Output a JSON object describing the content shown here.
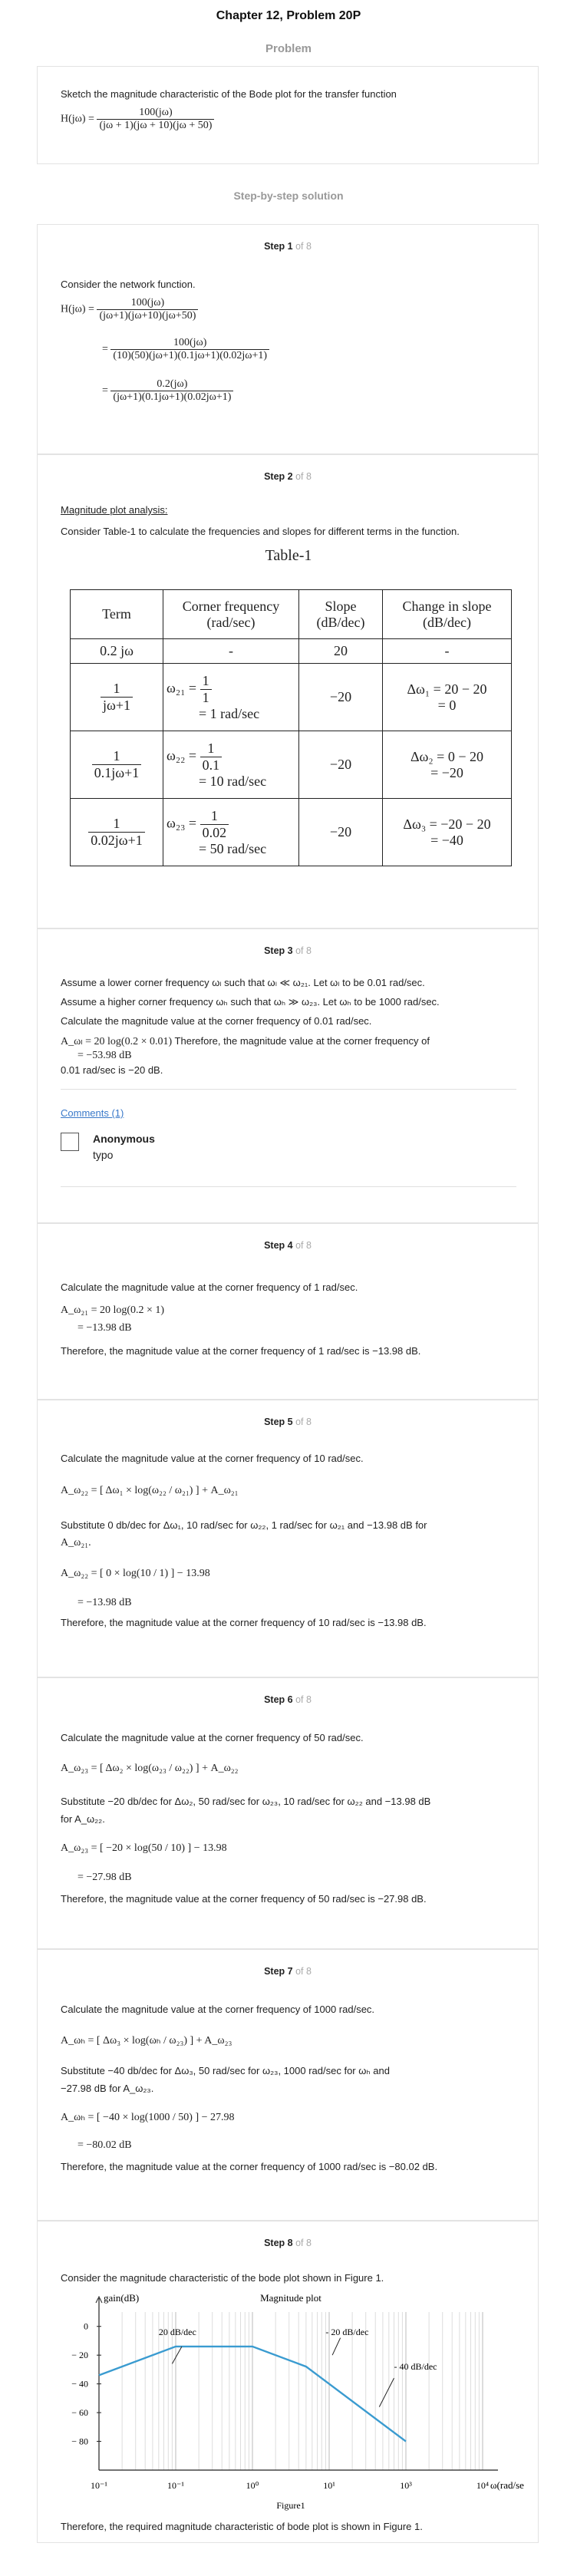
{
  "header": {
    "title": "Chapter 12, Problem 20P",
    "problem_label": "Problem",
    "solution_label": "Step-by-step solution"
  },
  "problem": {
    "text": "Sketch the magnitude characteristic of the Bode plot for the transfer function",
    "lhs": "H(jω) =",
    "num": "100(jω)",
    "den": "(jω + 1)(jω + 10)(jω + 50)"
  },
  "steps": [
    {
      "label": "Step 1",
      "of": "of 8"
    },
    {
      "label": "Step 2",
      "of": "of 8"
    },
    {
      "label": "Step 3",
      "of": "of 8"
    },
    {
      "label": "Step 4",
      "of": "of 8"
    },
    {
      "label": "Step 5",
      "of": "of 8"
    },
    {
      "label": "Step 6",
      "of": "of 8"
    },
    {
      "label": "Step 7",
      "of": "of 8"
    },
    {
      "label": "Step 8",
      "of": "of 8"
    }
  ],
  "step1": {
    "intro": "Consider the network function.",
    "lhs": "H(jω) =",
    "f1_num": "100(jω)",
    "f1_den": "(jω+1)(jω+10)(jω+50)",
    "f2_num": "100(jω)",
    "f2_den": "(10)(50)(jω+1)(0.1jω+1)(0.02jω+1)",
    "f3_num": "0.2(jω)",
    "f3_den": "(jω+1)(0.1jω+1)(0.02jω+1)"
  },
  "step2": {
    "heading": "Magnitude plot analysis:",
    "text": "Consider Table-1 to calculate the frequencies and slopes for different terms in the function.",
    "table_title": "Table-1",
    "headers": [
      "Term",
      "Corner frequency (rad/sec)",
      "Slope (dB/dec)",
      "Change in slope (dB/dec)"
    ],
    "row0": {
      "term": "0.2 jω",
      "freq": "-",
      "slope": "20",
      "change": "-"
    },
    "row1": {
      "num": "1",
      "den": "jω+1",
      "w": "ω₂₁ =",
      "fnum": "1",
      "fden": "1",
      "res": "= 1 rad/sec",
      "slope": "−20",
      "c1": "Δω₁ = 20 − 20",
      "c2": "= 0"
    },
    "row2": {
      "num": "1",
      "den": "0.1jω+1",
      "w": "ω₂₂ =",
      "fnum": "1",
      "fden": "0.1",
      "res": "= 10 rad/sec",
      "slope": "−20",
      "c1": "Δω₂ = 0 − 20",
      "c2": "= −20"
    },
    "row3": {
      "num": "1",
      "den": "0.02jω+1",
      "w": "ω₂₃ =",
      "fnum": "1",
      "fden": "0.02",
      "res": "= 50 rad/sec",
      "slope": "−20",
      "c1": "Δω₃ = −20 − 20",
      "c2": "= −40"
    }
  },
  "step3": {
    "l1": "Assume a lower corner frequency  ωₗ such that  ωₗ ≪ ω₂₁. Let  ωₗ to be  0.01 rad/sec.",
    "l2": "Assume a higher corner frequency  ωₕ such that  ωₕ ≫ ω₂₃. Let  ωₕ to be  1000 rad/sec.",
    "l3": "Calculate the magnitude value at the corner frequency of  0.01 rad/sec.",
    "eq1": "A_ωₗ = 20 log(0.2 × 0.01)",
    "eq1b": "Therefore, the magnitude value at the corner frequency of",
    "eq2": "= −53.98 dB",
    "eq3": "0.01 rad/sec  is  −20 dB.",
    "comments": "Comments (1)",
    "author": "Anonymous",
    "comment": "typo"
  },
  "step4": {
    "l1": "Calculate the magnitude value at the corner frequency of  1 rad/sec.",
    "eq1": "A_ω₂₁ = 20 log(0.2 × 1)",
    "eq2": "= −13.98 dB",
    "concl": "Therefore, the magnitude value at the corner frequency of  1 rad/sec  is  −13.98 dB."
  },
  "step5": {
    "l1": "Calculate the magnitude value at the corner frequency of  10 rad/sec.",
    "gen": "A_ω₂₂ = [ Δω₁ × log(ω₂₂ / ω₂₁) ] + A_ω₂₁",
    "sub1": "Substitute  0 db/dec  for  Δω₁,  10 rad/sec  for  ω₂₂,  1 rad/sec  for  ω₂₁  and  −13.98 dB  for",
    "sub2": "A_ω₂₁.",
    "eq": "A_ω₂₂ = [ 0 × log(10 / 1) ] − 13.98",
    "res": "= −13.98 dB",
    "concl": "Therefore, the magnitude value at the corner frequency of  10 rad/sec  is  −13.98 dB."
  },
  "step6": {
    "l1": "Calculate the magnitude value at the corner frequency of  50 rad/sec.",
    "gen": "A_ω₂₃ = [ Δω₂ × log(ω₂₃ / ω₂₂) ] + A_ω₂₂",
    "sub1": "Substitute  −20 db/dec  for  Δω₂,  50 rad/sec  for  ω₂₃,  10 rad/sec  for  ω₂₂  and  −13.98 dB",
    "sub2": "for  A_ω₂₂.",
    "eq": "A_ω₂₃ = [ −20 × log(50 / 10) ] − 13.98",
    "res": "= −27.98 dB",
    "concl": "Therefore, the magnitude value at the corner frequency of  50 rad/sec  is  −27.98 dB."
  },
  "step7": {
    "l1": "Calculate the magnitude value at the corner frequency of  1000 rad/sec.",
    "gen": "A_ωₕ = [ Δω₃ × log(ωₕ / ω₂₃) ] + A_ω₂₃",
    "sub1": "Substitute  −40 db/dec  for  Δω₃,  50 rad/sec  for  ω₂₃,  1000 rad/sec  for  ωₕ  and",
    "sub2": "−27.98 dB  for  A_ω₂₃.",
    "eq": "A_ωₕ = [ −40 × log(1000 / 50) ] − 27.98",
    "res": "= −80.02 dB",
    "concl": "Therefore, the magnitude value at the corner frequency of  1000 rad/sec  is  −80.02 dB."
  },
  "step8": {
    "l1": "Consider the magnitude characteristic of the bode plot shown in Figure 1.",
    "concl": "Therefore, the required magnitude characteristic of bode plot is shown in Figure 1."
  },
  "chart_data": {
    "type": "line",
    "title": "Magnitude plot",
    "xlabel": "ω(rad/sec)",
    "ylabel": "gain(dB)",
    "caption": "Figure1",
    "xscale": "log",
    "xlim": [
      0.1,
      10000
    ],
    "ylim": [
      -100,
      10
    ],
    "x_ticks": [
      "10⁻¹",
      "10⁻¹",
      "10⁰",
      "10¹",
      "10³",
      "10⁴"
    ],
    "y_ticks": [
      "0",
      "− 20",
      "− 40",
      "− 60",
      "− 80"
    ],
    "annotations": [
      "20 dB/dec",
      "- 20 dB/dec",
      "- 40 dB/dec"
    ],
    "series": [
      {
        "x": [
          0.1,
          1,
          10,
          50,
          1000
        ],
        "y": [
          -33.98,
          -13.98,
          -13.98,
          -27.98,
          -80.02
        ]
      }
    ],
    "line_color": "#3a9bd0"
  }
}
